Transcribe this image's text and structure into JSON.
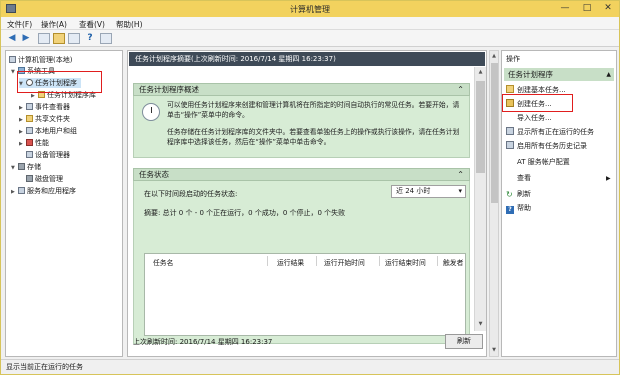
{
  "window": {
    "title": "计算机管理",
    "minimize": "—",
    "maximize": "□",
    "close": "✕"
  },
  "menu": [
    "文件(F)",
    "操作(A)",
    "查看(V)",
    "帮助(H)"
  ],
  "tree": {
    "items": [
      {
        "label": "计算机管理(本地)",
        "icon": "computer-icon"
      },
      {
        "label": "系统工具",
        "icon": "tools-icon"
      },
      {
        "label": "任务计划程序",
        "icon": "clock-icon"
      },
      {
        "label": "任务计划程序库",
        "icon": "folder-icon"
      },
      {
        "label": "事件查看器",
        "icon": "event-viewer-icon"
      },
      {
        "label": "共享文件夹",
        "icon": "folder-icon"
      },
      {
        "label": "本地用户和组",
        "icon": "users-icon"
      },
      {
        "label": "性能",
        "icon": "performance-icon"
      },
      {
        "label": "设备管理器",
        "icon": "device-icon"
      },
      {
        "label": "存储",
        "icon": "storage-icon"
      },
      {
        "label": "磁盘管理",
        "icon": "disk-icon"
      },
      {
        "label": "服务和应用程序",
        "icon": "services-icon"
      }
    ]
  },
  "center": {
    "header": "任务计划程序摘要(上次刷新时间: 2016/7/14 星期四 16:23:37)",
    "overview": {
      "title": "任务计划程序概述",
      "para1": "可以使用任务计划程序来创建和管理计算机将在所指定的时间自动执行的常见任务。若要开始，请单击“操作”菜单中的命令。",
      "para2": "任务存储在任务计划程序库的文件夹中。若要查看单独任务上的操作或执行该操作，请在任务计划程序库中选择该任务，然后在“操作”菜单中单击命令。"
    },
    "status": {
      "title": "任务状态",
      "label": "在以下时间段启动的任务状态:",
      "range_value": "近 24 小时",
      "summary": "摘要: 总计 0 个 - 0 个正在运行，0 个成功，0 个停止，0 个失败",
      "columns": [
        "任务名",
        "运行结果",
        "运行开始时间",
        "运行结束时间",
        "触发者"
      ]
    },
    "footer": "上次刷新时间: 2016/7/14 星期四 16:23:37",
    "refresh_label": "刷新"
  },
  "actions": {
    "title": "操作",
    "group": "任务计划程序",
    "items": [
      {
        "label": "创建基本任务...",
        "icon": "create-basic-task-icon"
      },
      {
        "label": "创建任务...",
        "icon": "create-task-icon"
      },
      {
        "label": "导入任务...",
        "icon": ""
      },
      {
        "label": "显示所有正在运行的任务",
        "icon": "running-tasks-icon"
      },
      {
        "label": "启用所有任务历史记录",
        "icon": "history-icon"
      },
      {
        "label": "AT 服务帐户配置",
        "icon": ""
      },
      {
        "label": "查看",
        "icon": ""
      },
      {
        "label": "刷新",
        "icon": "refresh-icon"
      },
      {
        "label": "帮助",
        "icon": "help-icon"
      }
    ]
  },
  "statusbar": "显示当前正在运行的任务",
  "colors": {
    "titlebar": "#f2d25e",
    "section_bg": "#d7ecd5",
    "section_head": "#c8dfc7",
    "highlight": "#e01e1e",
    "selection": "#cce4f7"
  }
}
